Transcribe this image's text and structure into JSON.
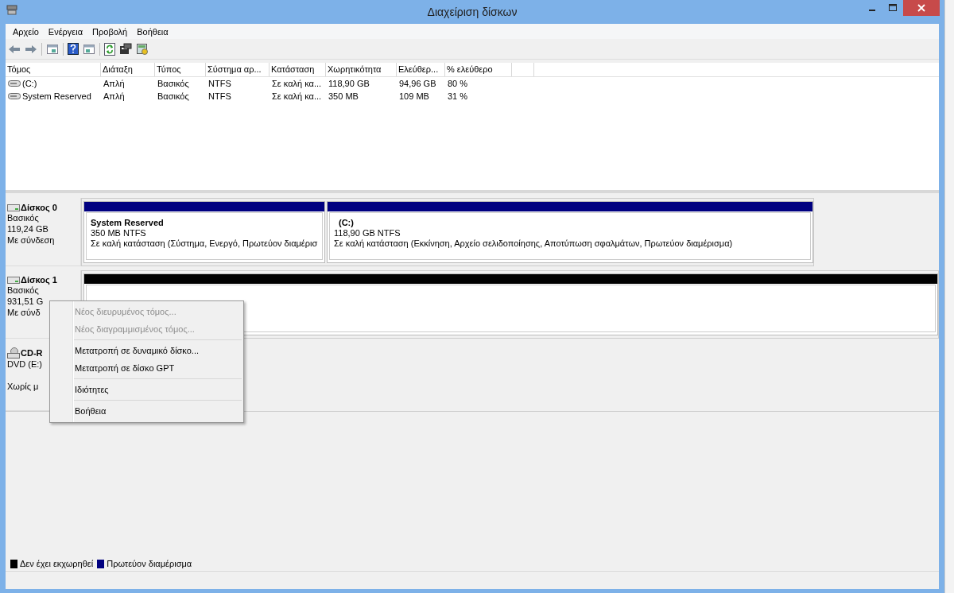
{
  "window": {
    "title": "Διαχείριση δίσκων"
  },
  "menu": [
    "Αρχείο",
    "Ενέργεια",
    "Προβολή",
    "Βοήθεια"
  ],
  "toolbar": [
    {
      "kind": "back"
    },
    {
      "kind": "forward"
    },
    {
      "kind": "separator"
    },
    {
      "kind": "tree"
    },
    {
      "kind": "separator"
    },
    {
      "kind": "help"
    },
    {
      "kind": "pane"
    },
    {
      "kind": "separator"
    },
    {
      "kind": "refresh"
    },
    {
      "kind": "properties"
    },
    {
      "kind": "check"
    }
  ],
  "table": {
    "columns": [
      "Τόμος",
      "Διάταξη",
      "Τύπος",
      "Σύστημα αρ...",
      "Κατάσταση",
      "Χωρητικότητα",
      "Ελεύθερ...",
      "% ελεύθερο"
    ],
    "rows": [
      [
        "(C:)",
        "Απλή",
        "Βασικός",
        "NTFS",
        "Σε καλή κα...",
        "118,90 GB",
        "94,96 GB",
        "80 %"
      ],
      [
        "System Reserved",
        "Απλή",
        "Βασικός",
        "NTFS",
        "Σε καλή κα...",
        "350 MB",
        "109 MB",
        "31 %"
      ]
    ]
  },
  "disks": [
    {
      "kind": "disk",
      "name": "Δίσκος 0",
      "lines": [
        "Βασικός",
        "119,24 GB",
        "Με σύνδεση"
      ],
      "partitions": [
        {
          "name": "System Reserved",
          "size": "350 MB NTFS",
          "status": "Σε καλή κατάσταση (Σύστημα, Ενεργό, Πρωτεύον διαμέρισ",
          "color": "#000080"
        },
        {
          "name": "(C:)",
          "size": "118,90 GB NTFS",
          "status": "Σε καλή κατάσταση (Εκκίνηση, Αρχείο σελιδοποίησης, Αποτύπωση σφαλμάτων, Πρωτεύον διαμέρισμα)",
          "color": "#000080"
        }
      ]
    },
    {
      "kind": "disk",
      "name": "Δίσκος 1",
      "lines": [
        "Βασικός",
        "931,51 G",
        "Με σύνδ"
      ],
      "partitions": [
        {
          "color": "#000000"
        }
      ]
    },
    {
      "kind": "cdrom",
      "name": "CD-R",
      "lines": [
        "DVD (E:)"
      ],
      "note": "Χωρίς μ"
    }
  ],
  "context_menu": {
    "groups": [
      [
        {
          "label": "Νέος διευρυμένος τόμος...",
          "disabled": true
        },
        {
          "label": "Νέος διαγραμμισμένος τόμος...",
          "disabled": true
        }
      ],
      [
        {
          "label": "Μετατροπή σε δυναμικό δίσκο...",
          "disabled": false
        },
        {
          "label": "Μετατροπή σε δίσκο GPT",
          "disabled": false
        }
      ],
      [
        {
          "label": "Ιδιότητες",
          "disabled": false
        }
      ],
      [
        {
          "label": "Βοήθεια",
          "disabled": false
        }
      ]
    ]
  },
  "legend": [
    {
      "label": "Δεν έχει εκχωρηθεί",
      "color": "#000000"
    },
    {
      "label": "Πρωτεύον διαμέρισμα",
      "color": "#000080"
    }
  ]
}
